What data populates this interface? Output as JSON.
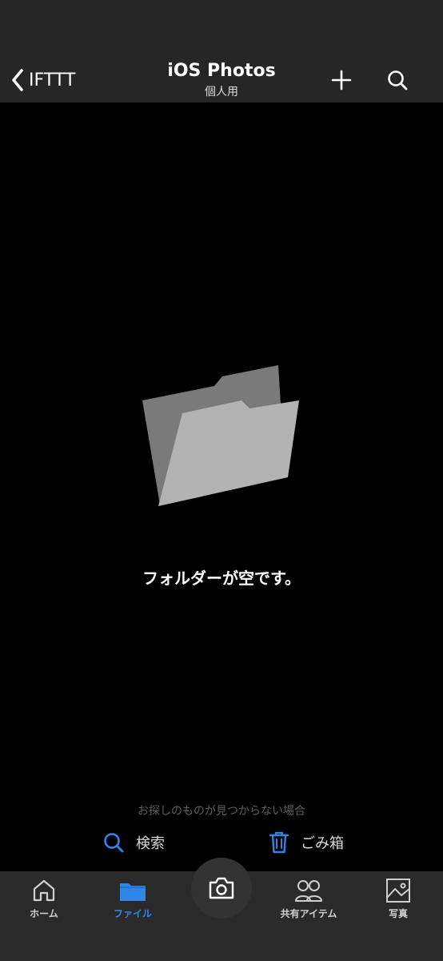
{
  "nav": {
    "back_label": "IFTTT",
    "title": "iOS Photos",
    "subtitle": "個人用",
    "add_icon": "plus-icon",
    "search_icon": "search-icon"
  },
  "empty_state": {
    "message": "フォルダーが空です。"
  },
  "help": {
    "hint": "お探しのものが見つからない場合",
    "search_label": "検索",
    "trash_label": "ごみ箱"
  },
  "tabs": [
    {
      "label": "ホーム",
      "icon": "home-icon",
      "active": false
    },
    {
      "label": "ファイル",
      "icon": "folder-icon",
      "active": true
    },
    {
      "label": "共有アイテム",
      "icon": "people-icon",
      "active": false
    },
    {
      "label": "写真",
      "icon": "photo-icon",
      "active": false
    }
  ],
  "camera": {
    "icon": "camera-icon"
  },
  "colors": {
    "accent": "#2f86e8",
    "bar_background": "#262626",
    "background": "#000000"
  }
}
